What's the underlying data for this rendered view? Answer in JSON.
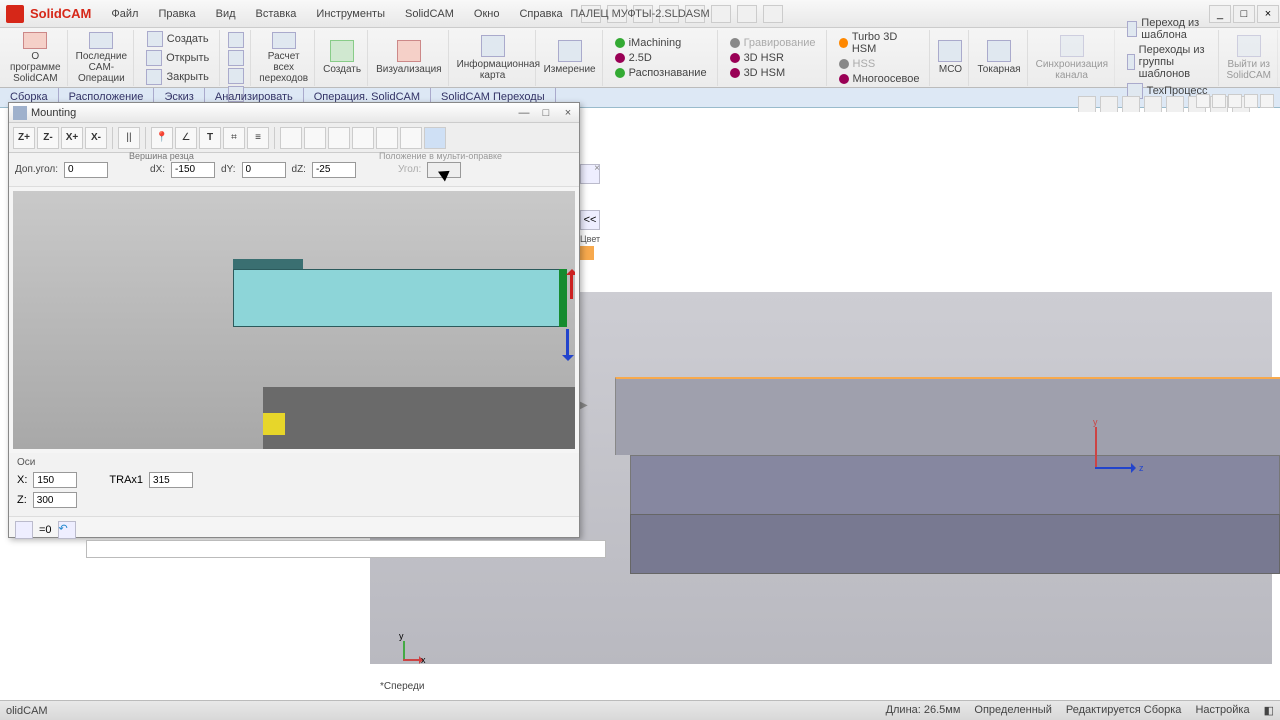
{
  "app": {
    "name": "SolidCAM",
    "document": "ПАЛЕЦ МУФТЫ-2.SLDASM"
  },
  "menu": {
    "file": "Файл",
    "edit": "Правка",
    "view": "Вид",
    "insert": "Вставка",
    "tools": "Инструменты",
    "solidcam": "SolidCAM",
    "window": "Окно",
    "help": "Справка"
  },
  "ribbon": {
    "about": "О программе SolidCAM",
    "lastops": "Последние CAM-Операции",
    "create": "Создать",
    "open": "Открыть",
    "close": "Закрыть",
    "calc": "Расчет всех переходов",
    "create2": "Создать",
    "visual": "Визуализация",
    "info": "Информационная карта",
    "measure": "Измерение",
    "imachining": "iMachining",
    "twohalfd": "2.5D",
    "recognize": "Распознавание",
    "engraving": "Гравирование",
    "hsr": "3D HSR",
    "hsm": "3D HSM",
    "turbohsm": "Turbo 3D HSM",
    "hss": "HSS",
    "multiaxis": "Многоосевое",
    "mco": "МСО",
    "turning": "Токарная",
    "sync": "Синхронизация канала",
    "fromtemplate": "Переход из шаблона",
    "fromgroup": "Переходы из группы шаблонов",
    "tehprocess": "ТехПроцесс",
    "exit": "Выйти из SolidCAM"
  },
  "tabs": {
    "assembly": "Сборка",
    "layout": "Расположение",
    "sketch": "Эскиз",
    "analyze": "Анализировать",
    "op": "Операция. SolidCAM",
    "transitions": "SolidCAM Переходы"
  },
  "sidepanel": {
    "back": "<<",
    "color": "Цвет"
  },
  "dialog": {
    "title": "Mounting",
    "zplus": "Z+",
    "zminus": "Z-",
    "xplus": "X+",
    "xminus": "X-",
    "group_tip": "Вершина резца",
    "group_multi": "Положение в мульти-оправке",
    "addangle_label": "Доп.угол:",
    "addangle": "0",
    "dx_label": "dX:",
    "dx": "-150",
    "dy_label": "dY:",
    "dy": "0",
    "dz_label": "dZ:",
    "dz": "-25",
    "angle_label": "Угол:",
    "angle": "",
    "axes_header": "Оси",
    "x_label": "X:",
    "x": "150",
    "trax_label": "TRAx1",
    "trax": "315",
    "z_label": "Z:",
    "z": "300",
    "eq": "=0"
  },
  "mainview": {
    "orientation": "*Спереди",
    "axis_x": "x",
    "axis_y": "y",
    "axis_z": "z"
  },
  "status": {
    "left": "olidCAM",
    "len": "Длина: 26.5мм",
    "def": "Определенный",
    "edit": "Редактируется Сборка",
    "setup": "Настройка"
  }
}
